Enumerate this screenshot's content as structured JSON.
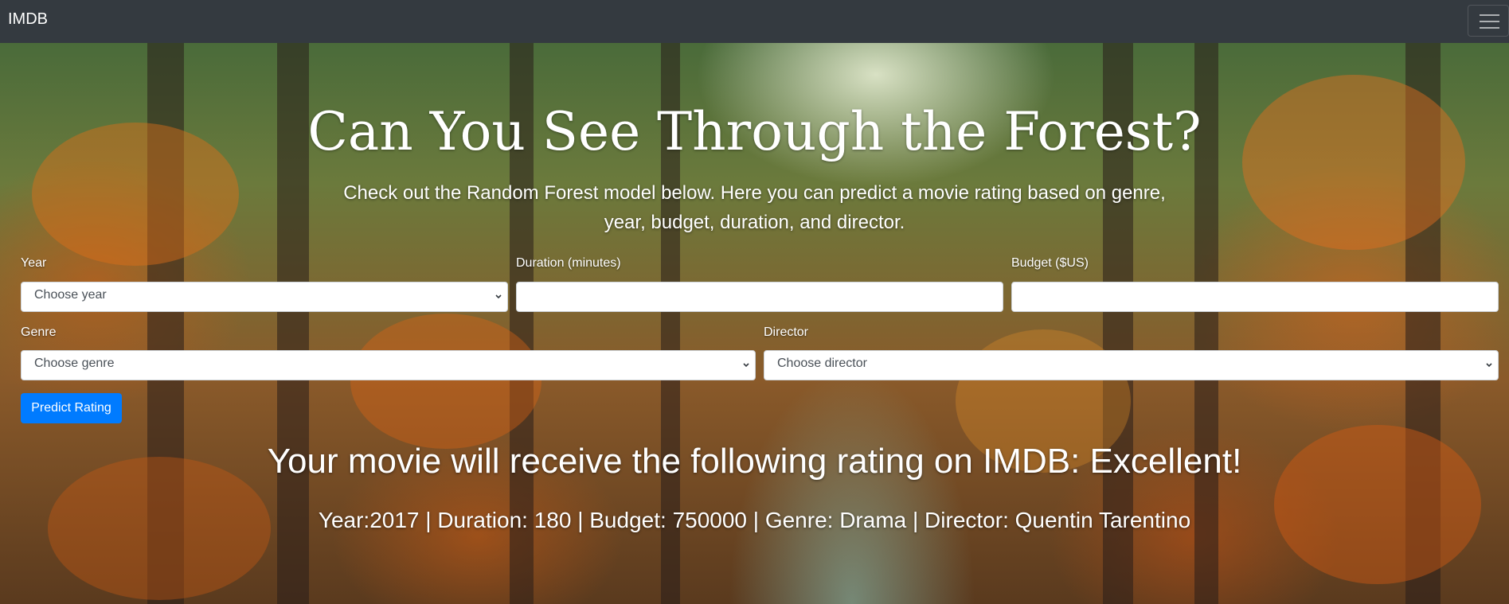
{
  "navbar": {
    "brand": "IMDB",
    "toggler_icon": "hamburger-icon"
  },
  "hero": {
    "title": "Can You See Through the Forest?",
    "lead": "Check out the Random Forest model below. Here you can predict a movie rating based on genre, year, budget, duration, and director."
  },
  "form": {
    "year": {
      "label": "Year",
      "value": "Choose year"
    },
    "duration": {
      "label": "Duration (minutes)",
      "value": ""
    },
    "budget": {
      "label": "Budget ($US)",
      "value": ""
    },
    "genre": {
      "label": "Genre",
      "value": "Choose genre"
    },
    "director": {
      "label": "Director",
      "value": "Choose director"
    },
    "submit_label": "Predict Rating"
  },
  "result": {
    "headline": "Your movie will receive the following rating on IMDB: Excellent!",
    "summary": "Year:2017 | Duration: 180 | Budget: 750000 | Genre: Drama | Director: Quentin Tarentino"
  },
  "colors": {
    "navbar": "#343a40",
    "primary_button": "#007bff"
  }
}
